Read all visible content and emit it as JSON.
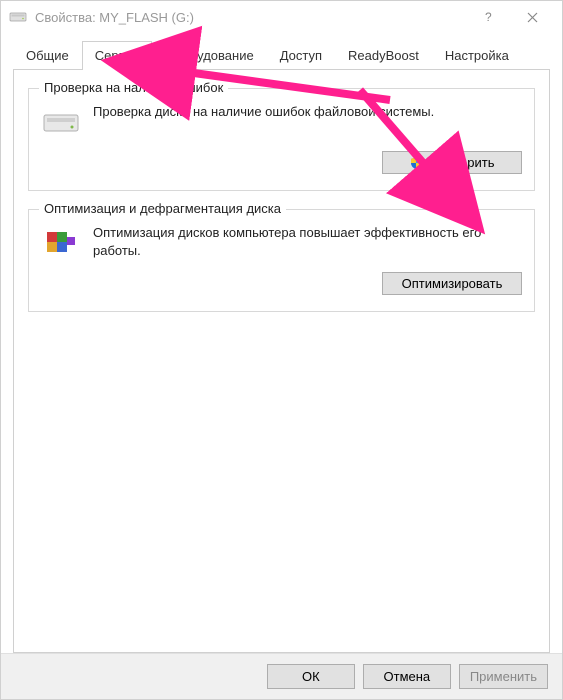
{
  "window": {
    "title": "Свойства: MY_FLASH (G:)"
  },
  "tabs": {
    "general": "Общие",
    "service": "Сервис",
    "hardware": "Оборудование",
    "access": "Доступ",
    "readyboost": "ReadyBoost",
    "settings": "Настройка"
  },
  "active_tab": "service",
  "groups": {
    "check": {
      "title": "Проверка на наличие ошибок",
      "text": "Проверка диска на наличие ошибок файловой системы.",
      "button": "Проверить"
    },
    "optimize": {
      "title": "Оптимизация и дефрагментация диска",
      "text": "Оптимизация дисков компьютера повышает эффективность его работы.",
      "button": "Оптимизировать"
    }
  },
  "footer": {
    "ok": "ОК",
    "cancel": "Отмена",
    "apply": "Применить"
  },
  "annotations": {
    "arrow_to": [
      "service-tab",
      "check-button"
    ],
    "arrow_color": "#ff1f8f"
  }
}
